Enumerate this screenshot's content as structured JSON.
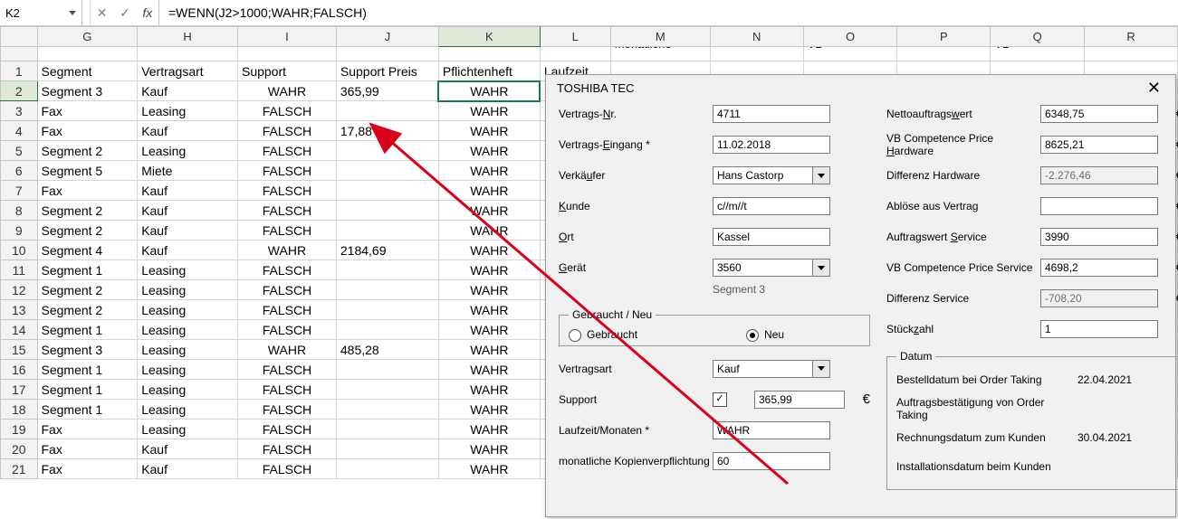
{
  "formula_bar": {
    "cell_ref": "K2",
    "cancel_glyph": "✕",
    "accept_glyph": "✓",
    "fx_label": "fx",
    "formula": "=WENN(J2>1000;WAHR;FALSCH)"
  },
  "columns": [
    "G",
    "H",
    "I",
    "J",
    "K",
    "L",
    "M",
    "N",
    "O",
    "P",
    "Q",
    "R"
  ],
  "peek_row": {
    "M": "monatliche",
    "O": "VB",
    "Q": "VB"
  },
  "header_row": [
    "Segment",
    "Vertragsart",
    "Support",
    "Support Preis",
    "Pflichtenheft",
    "Laufzeit",
    "",
    "",
    "",
    "",
    "",
    ""
  ],
  "rows": [
    {
      "n": 2,
      "c": [
        "Segment 3",
        "Kauf",
        "WAHR",
        "365,99",
        "WAHR",
        "",
        "",
        "",
        "",
        "",
        "",
        ""
      ]
    },
    {
      "n": 3,
      "c": [
        "Fax",
        "Leasing",
        "FALSCH",
        "",
        "WAHR",
        "",
        "",
        "",
        "",
        "",
        "",
        ""
      ]
    },
    {
      "n": 4,
      "c": [
        "Fax",
        "Kauf",
        "FALSCH",
        "17,88",
        "WAHR",
        "",
        "",
        "",
        "",
        "",
        "",
        ""
      ]
    },
    {
      "n": 5,
      "c": [
        "Segment 2",
        "Leasing",
        "FALSCH",
        "",
        "WAHR",
        "",
        "",
        "",
        "",
        "",
        "",
        ""
      ]
    },
    {
      "n": 6,
      "c": [
        "Segment 5",
        "Miete",
        "FALSCH",
        "",
        "WAHR",
        "",
        "",
        "",
        "",
        "",
        "",
        ""
      ]
    },
    {
      "n": 7,
      "c": [
        "Fax",
        "Kauf",
        "FALSCH",
        "",
        "WAHR",
        "",
        "",
        "",
        "",
        "",
        "",
        ""
      ]
    },
    {
      "n": 8,
      "c": [
        "Segment 2",
        "Kauf",
        "FALSCH",
        "",
        "WAHR",
        "",
        "",
        "",
        "",
        "",
        "",
        ""
      ]
    },
    {
      "n": 9,
      "c": [
        "Segment 2",
        "Kauf",
        "FALSCH",
        "",
        "WAHR",
        "",
        "",
        "",
        "",
        "",
        "",
        ""
      ]
    },
    {
      "n": 10,
      "c": [
        "Segment 4",
        "Kauf",
        "WAHR",
        "2184,69",
        "WAHR",
        "",
        "",
        "",
        "",
        "",
        "",
        ""
      ]
    },
    {
      "n": 11,
      "c": [
        "Segment 1",
        "Leasing",
        "FALSCH",
        "",
        "WAHR",
        "",
        "",
        "",
        "",
        "",
        "",
        ""
      ]
    },
    {
      "n": 12,
      "c": [
        "Segment 2",
        "Leasing",
        "FALSCH",
        "",
        "WAHR",
        "",
        "",
        "",
        "",
        "",
        "",
        ""
      ]
    },
    {
      "n": 13,
      "c": [
        "Segment 2",
        "Leasing",
        "FALSCH",
        "",
        "WAHR",
        "",
        "",
        "",
        "",
        "",
        "",
        ""
      ]
    },
    {
      "n": 14,
      "c": [
        "Segment 1",
        "Leasing",
        "FALSCH",
        "",
        "WAHR",
        "",
        "",
        "",
        "",
        "",
        "",
        ""
      ]
    },
    {
      "n": 15,
      "c": [
        "Segment 3",
        "Leasing",
        "WAHR",
        "485,28",
        "WAHR",
        "",
        "",
        "",
        "",
        "",
        "",
        ""
      ]
    },
    {
      "n": 16,
      "c": [
        "Segment 1",
        "Leasing",
        "FALSCH",
        "",
        "WAHR",
        "",
        "",
        "",
        "",
        "",
        "",
        ""
      ]
    },
    {
      "n": 17,
      "c": [
        "Segment 1",
        "Leasing",
        "FALSCH",
        "",
        "WAHR",
        "",
        "",
        "",
        "",
        "",
        "",
        ""
      ]
    },
    {
      "n": 18,
      "c": [
        "Segment 1",
        "Leasing",
        "FALSCH",
        "",
        "WAHR",
        "",
        "",
        "",
        "",
        "",
        "",
        ""
      ]
    },
    {
      "n": 19,
      "c": [
        "Fax",
        "Leasing",
        "FALSCH",
        "",
        "WAHR",
        "",
        "",
        "",
        "",
        "",
        "",
        ""
      ]
    },
    {
      "n": 20,
      "c": [
        "Fax",
        "Kauf",
        "FALSCH",
        "",
        "WAHR",
        "",
        "",
        "",
        "",
        "",
        "",
        ""
      ]
    },
    {
      "n": 21,
      "c": [
        "Fax",
        "Kauf",
        "FALSCH",
        "",
        "WAHR",
        "",
        "",
        "",
        "",
        "",
        "",
        ""
      ]
    }
  ],
  "dialog": {
    "title": "TOSHIBA TEC",
    "left": {
      "vertrags_nr": {
        "label": "Vertrags-<u>N</u>r.",
        "value": "4711"
      },
      "eingang": {
        "label": "Vertrags-<u>E</u>ingang *",
        "value": "11.02.2018"
      },
      "verkaeufer": {
        "label": "Verkä<u>u</u>fer",
        "value": "Hans Castorp"
      },
      "kunde": {
        "label": "<u>K</u>unde",
        "value": "c//m//t"
      },
      "ort": {
        "label": "<u>O</u>rt",
        "value": "Kassel"
      },
      "geraet": {
        "label": "<u>G</u>erät",
        "value": "3560"
      },
      "segment": "Segment 3",
      "gbr_neu": {
        "legend": "Gebraucht / Neu",
        "opt1": "Gebraucht",
        "opt2": "Neu"
      },
      "vertragsart": {
        "label": "Vertragsart",
        "value": "Kauf"
      },
      "support": {
        "label": "Support",
        "checked": true,
        "value": "365,99",
        "euro": "€"
      },
      "laufzeit": {
        "label": "Laufzeit/Monaten *",
        "value": "WAHR"
      },
      "kopien": {
        "label": "monatliche Kopienverpflichtung",
        "value": "60"
      }
    },
    "right": {
      "netto": {
        "label": "Nettoauftrags<u>w</u>ert",
        "value": "6348,75",
        "euro": "€"
      },
      "vbhw": {
        "label": "VB Competence Price <u>H</u>ardware",
        "value": "8625,21",
        "euro": "€"
      },
      "diffhw": {
        "label": "Differenz Hardware",
        "value": "-2.276,46",
        "euro": "€",
        "ro": true
      },
      "abloese": {
        "label": "Ablöse aus Vertrag",
        "value": "",
        "euro": "€"
      },
      "service": {
        "label": "Auftragswert <u>S</u>ervice",
        "value": "3990",
        "euro": "€"
      },
      "vbserv": {
        "label": "VB Competence Price Service",
        "value": "4698,2",
        "euro": "€"
      },
      "diffserv": {
        "label": "Differenz Service",
        "value": "-708,20",
        "euro": "€",
        "ro": true
      },
      "stueck": {
        "label": "Stück<u>z</u>ahl",
        "value": "1"
      },
      "datum": {
        "legend": "Datum",
        "bestell": {
          "label": "Bestelldatum bei Order Taking",
          "value": "22.04.2021"
        },
        "auftragb": {
          "label": "Auftragsbestätigung von Order Taking",
          "value": ""
        },
        "rechnung": {
          "label": "Rechnungsdatum zum Kunden",
          "value": "30.04.2021"
        },
        "install": {
          "label": "Installationsdatum beim Kunden",
          "value": ""
        }
      }
    }
  }
}
